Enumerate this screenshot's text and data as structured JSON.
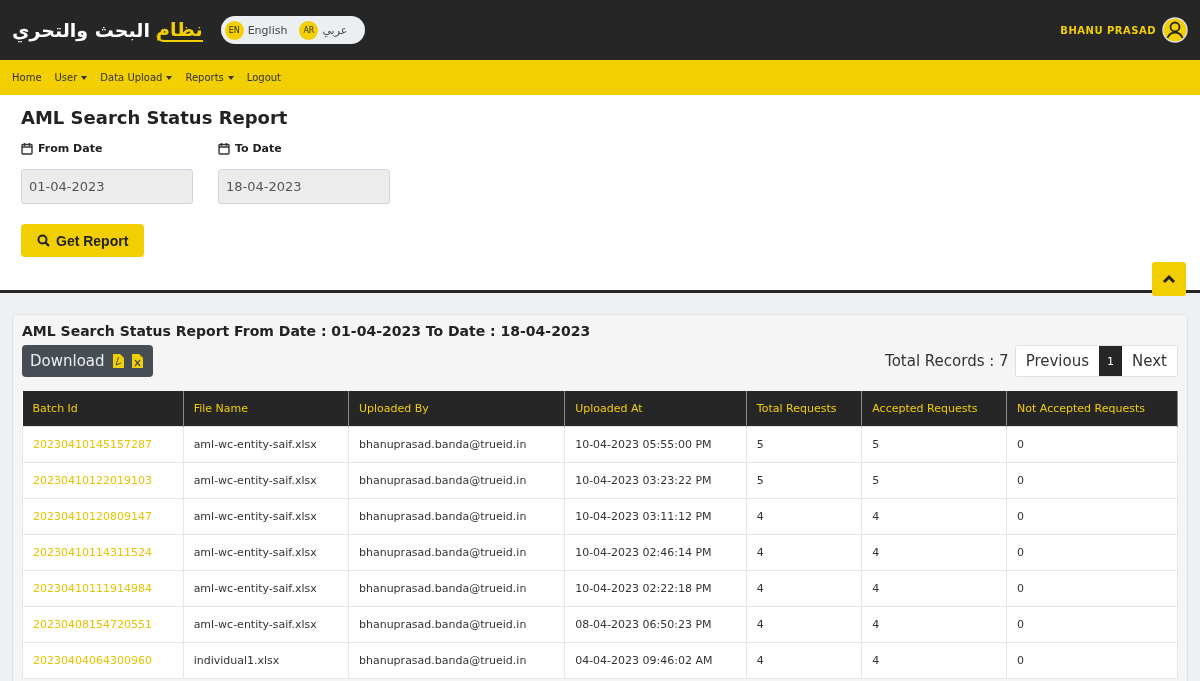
{
  "header": {
    "logo": {
      "accent": "نظام",
      "rest": "البحث والتحري"
    },
    "languages": [
      {
        "code": "EN",
        "label": "English"
      },
      {
        "code": "AR",
        "label": "عربي"
      }
    ],
    "user": "BHANU PRASAD"
  },
  "nav": [
    {
      "label": "Home",
      "has_menu": false
    },
    {
      "label": "User",
      "has_menu": true
    },
    {
      "label": "Data Upload",
      "has_menu": true
    },
    {
      "label": "Reports",
      "has_menu": true
    },
    {
      "label": "Logout",
      "has_menu": false
    }
  ],
  "form": {
    "title": "AML Search Status Report",
    "fields": [
      {
        "label": "From Date",
        "value": "01-04-2023"
      },
      {
        "label": "To Date",
        "value": "18-04-2023"
      }
    ],
    "button": "Get Report"
  },
  "report": {
    "title": "AML Search Status Report From Date : 01-04-2023 To Date : 18-04-2023",
    "download": "Download",
    "total": "Total Records : 7",
    "pagination": [
      {
        "label": "Previous",
        "selected": false
      },
      {
        "label": "1",
        "selected": true
      },
      {
        "label": "Next",
        "selected": false
      }
    ],
    "columns": [
      "Batch Id",
      "File Name",
      "Uploaded By",
      "Uploaded At",
      "Total Requests",
      "Accepted Requests",
      "Not Accepted Requests"
    ],
    "rows": [
      [
        "20230410145157287",
        "aml-wc-entity-saif.xlsx",
        "bhanuprasad.banda@trueid.in",
        "10-04-2023 05:55:00 PM",
        "5",
        "5",
        "0"
      ],
      [
        "20230410122019103",
        "aml-wc-entity-saif.xlsx",
        "bhanuprasad.banda@trueid.in",
        "10-04-2023 03:23:22 PM",
        "5",
        "5",
        "0"
      ],
      [
        "20230410120809147",
        "aml-wc-entity-saif.xlsx",
        "bhanuprasad.banda@trueid.in",
        "10-04-2023 03:11:12 PM",
        "4",
        "4",
        "0"
      ],
      [
        "20230410114311524",
        "aml-wc-entity-saif.xlsx",
        "bhanuprasad.banda@trueid.in",
        "10-04-2023 02:46:14 PM",
        "4",
        "4",
        "0"
      ],
      [
        "20230410111914984",
        "aml-wc-entity-saif.xlsx",
        "bhanuprasad.banda@trueid.in",
        "10-04-2023 02:22:18 PM",
        "4",
        "4",
        "0"
      ],
      [
        "20230408154720551",
        "aml-wc-entity-saif.xlsx",
        "bhanuprasad.banda@trueid.in",
        "08-04-2023 06:50:23 PM",
        "4",
        "4",
        "0"
      ],
      [
        "20230404064300960",
        "individual1.xlsx",
        "bhanuprasad.banda@trueid.in",
        "04-04-2023 09:46:02 AM",
        "4",
        "4",
        "0"
      ]
    ]
  }
}
